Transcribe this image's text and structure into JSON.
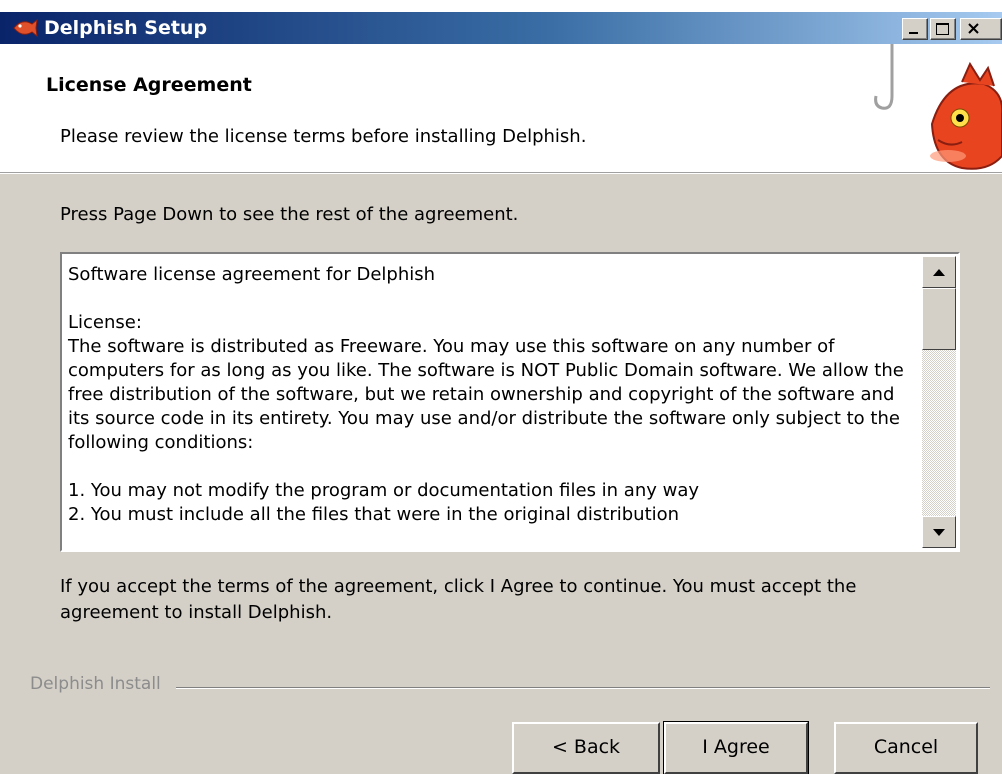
{
  "window": {
    "title": "Delphish Setup"
  },
  "header": {
    "title": "License Agreement",
    "subtitle": "Please review the license terms before installing Delphish."
  },
  "instructions": "Press Page Down to see the rest of the agreement.",
  "license": {
    "text": "Software license agreement for Delphish\n\nLicense:\nThe software is distributed as Freeware. You may use this software on any number of computers for as long as you like. The software is NOT Public Domain software. We allow the free distribution of the software, but we retain ownership and copyright of the software and its source code in its entirety. You may use and/or distribute the software only subject to the following conditions:\n\n1. You may not modify the program or documentation files in any way\n2. You must include all the files that were in the original distribution"
  },
  "accept_text": "If you accept the terms of the agreement, click I Agree to continue. You must accept the agreement to install Delphish.",
  "footer": {
    "brand": "Delphish Install"
  },
  "buttons": {
    "back": "< Back",
    "agree": "I Agree",
    "cancel": "Cancel"
  },
  "icons": {
    "app": "fish-icon",
    "minimize": "minimize-icon",
    "maximize": "maximize-icon",
    "close": "close-icon",
    "scroll_up": "arrow-up-icon",
    "scroll_down": "arrow-down-icon"
  }
}
